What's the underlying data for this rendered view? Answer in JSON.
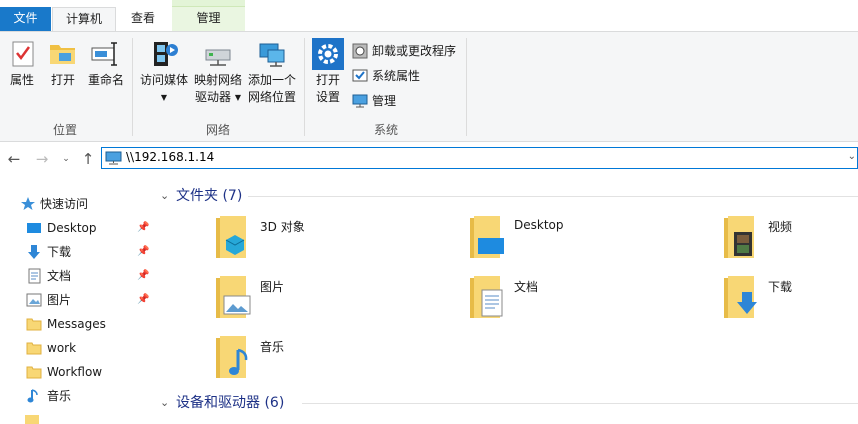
{
  "ribbon_tabs": {
    "file": "文件",
    "computer": "计算机",
    "view": "查看",
    "manage": "管理"
  },
  "ribbon": {
    "location_group": {
      "label": "位置",
      "buttons": [
        "属性",
        "打开",
        "重命名"
      ]
    },
    "network_group": {
      "label": "网络",
      "access_media_line1": "访问媒体",
      "map_drive_line1": "映射网络",
      "map_drive_line2": "驱动器",
      "add_location_line1": "添加一个",
      "add_location_line2": "网络位置"
    },
    "system_group": {
      "label": "系统",
      "open_settings_line1": "打开",
      "open_settings_line2": "设置",
      "uninstall": "卸载或更改程序",
      "system_properties": "系统属性",
      "manage": "管理"
    }
  },
  "address_bar": {
    "path": "\\\\192.168.1.14"
  },
  "nav_pane": {
    "quick_access": "快速访问",
    "items": [
      {
        "label": "Desktop",
        "icon": "desktop-icon",
        "pinned": true
      },
      {
        "label": "下载",
        "icon": "download-arrow-icon",
        "pinned": true
      },
      {
        "label": "文档",
        "icon": "document-icon",
        "pinned": true
      },
      {
        "label": "图片",
        "icon": "picture-icon",
        "pinned": true
      },
      {
        "label": "Messages",
        "icon": "folder-icon",
        "pinned": false
      },
      {
        "label": "work",
        "icon": "folder-icon",
        "pinned": false
      },
      {
        "label": "Workflow",
        "icon": "folder-icon",
        "pinned": false
      },
      {
        "label": "音乐",
        "icon": "music-note-icon",
        "pinned": false
      }
    ]
  },
  "content": {
    "folders_header": "文件夹 (7)",
    "devices_header": "设备和驱动器 (6)",
    "folders": [
      {
        "label": "3D 对象",
        "icon": "3d-objects-folder-icon"
      },
      {
        "label": "Desktop",
        "icon": "desktop-folder-icon"
      },
      {
        "label": "视频",
        "icon": "videos-folder-icon"
      },
      {
        "label": "图片",
        "icon": "pictures-folder-icon"
      },
      {
        "label": "文档",
        "icon": "documents-folder-icon"
      },
      {
        "label": "下载",
        "icon": "downloads-folder-icon"
      },
      {
        "label": "音乐",
        "icon": "music-folder-icon"
      }
    ]
  },
  "colors": {
    "file_tab": "#1979ca",
    "ribbon_bg": "#f5f6f7",
    "manage_tab": "#eaf6e1",
    "address_border": "#0078d7",
    "section_header": "#1e3287",
    "folder_yellow": "#f8d775"
  }
}
